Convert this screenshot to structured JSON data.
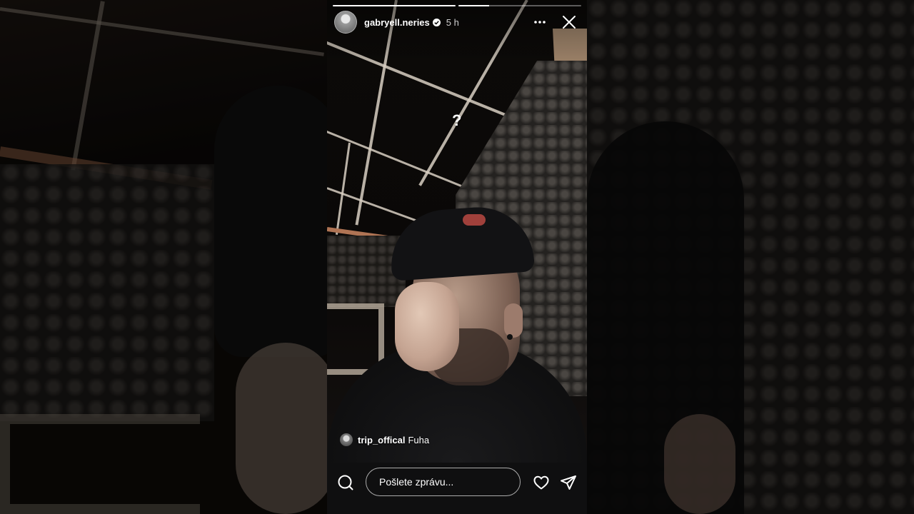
{
  "story": {
    "username": "gabryell.neries",
    "verified": true,
    "time_ago": "5 h",
    "progress": [
      1.0,
      0.25
    ],
    "overlay_text": "?",
    "comment": {
      "user": "trip_offical",
      "text": "Fuha"
    },
    "reply": {
      "placeholder": "Pošlete zprávu..."
    }
  },
  "icons": {
    "more": "more-horizontal-icon",
    "close": "close-icon",
    "search": "search-icon",
    "like": "heart-icon",
    "share": "send-icon",
    "verified": "verified-badge-icon"
  }
}
